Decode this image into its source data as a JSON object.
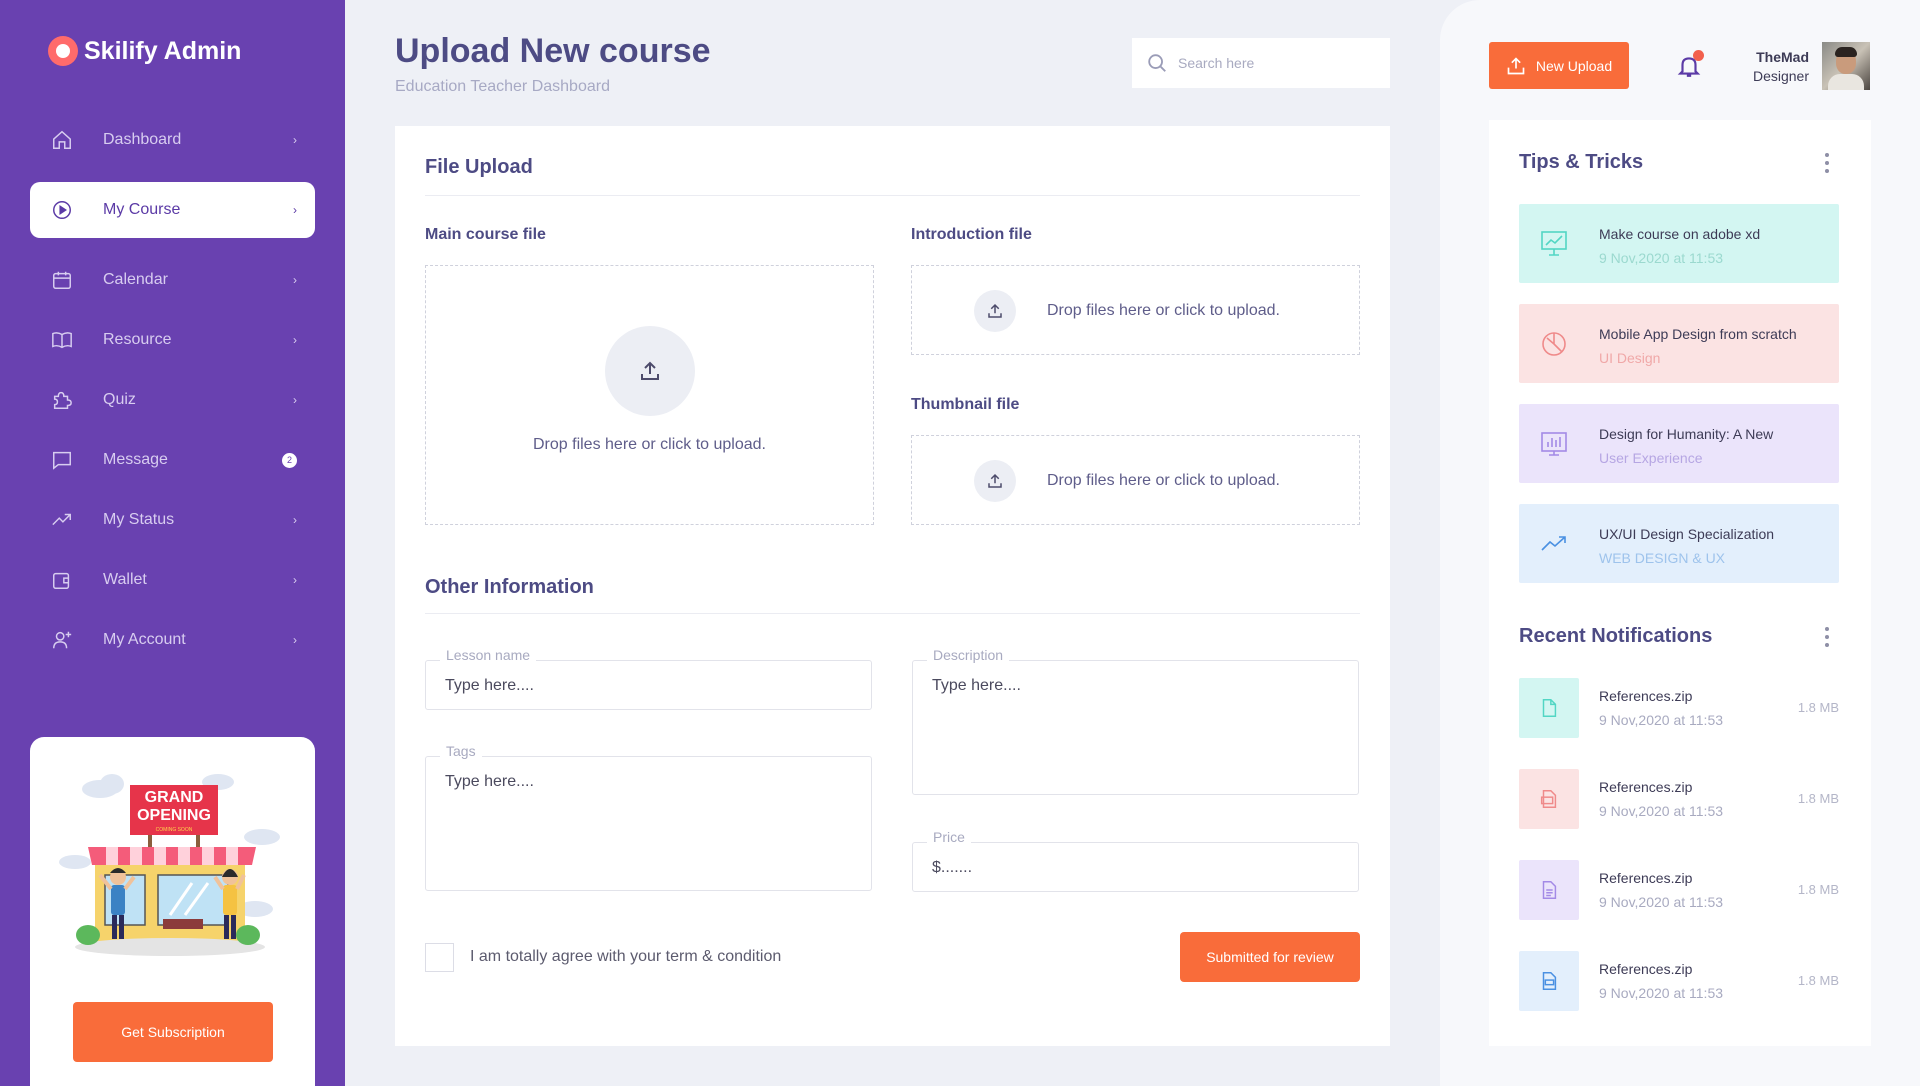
{
  "brand": {
    "name": "Skilify Admin"
  },
  "sidebar": {
    "items": [
      {
        "label": "Dashboard",
        "icon": "home-icon",
        "active": false
      },
      {
        "label": "My Course",
        "icon": "play-circle-icon",
        "active": true
      },
      {
        "label": "Calendar",
        "icon": "calendar-icon",
        "active": false
      },
      {
        "label": "Resource",
        "icon": "book-icon",
        "active": false
      },
      {
        "label": "Quiz",
        "icon": "puzzle-icon",
        "active": false
      },
      {
        "label": "Message",
        "icon": "message-icon",
        "active": false,
        "badge": "2"
      },
      {
        "label": "My Status",
        "icon": "trending-up-icon",
        "active": false
      },
      {
        "label": "Wallet",
        "icon": "wallet-icon",
        "active": false
      },
      {
        "label": "My Account",
        "icon": "user-plus-icon",
        "active": false
      }
    ],
    "promo": {
      "sign_line1": "GRAND",
      "sign_line2": "OPENING",
      "sign_line3": "COMING SOON",
      "button_label": "Get Subscription"
    }
  },
  "header": {
    "title": "Upload New course",
    "subtitle": "Education Teacher Dashboard",
    "search_placeholder": "Search here"
  },
  "file_upload": {
    "title": "File Upload",
    "main_label": "Main course file",
    "intro_label": "Introduction file",
    "thumb_label": "Thumbnail file",
    "drop_text": "Drop files here or click to upload."
  },
  "other_info": {
    "title": "Other Information",
    "lesson_name": {
      "label": "Lesson name",
      "value": "Type here...."
    },
    "tags": {
      "label": "Tags",
      "value": "Type here...."
    },
    "description": {
      "label": "Description",
      "value": "Type here...."
    },
    "price": {
      "label": "Price",
      "value": "$......."
    },
    "agree_text": "I am totally agree with your term & condition",
    "submit_label": "Submitted for review"
  },
  "topbar": {
    "upload_label": "New Upload",
    "user_name": "TheMad",
    "user_role": "Designer"
  },
  "tips": {
    "title": "Tips & Tricks",
    "items": [
      {
        "title": "Make course on adobe xd",
        "subtitle": "9 Nov,2020 at 11:53",
        "icon": "presentation-chart-icon",
        "bg": "#d3f6f2",
        "color": "#52d6c4"
      },
      {
        "title": "Mobile App Design from scratch",
        "subtitle": "UI Design",
        "icon": "pie-chart-icon",
        "bg": "#fbe3e3",
        "color": "#ef8a8a"
      },
      {
        "title": "Design for Humanity: A New",
        "subtitle": "User Experience",
        "icon": "bar-chart-icon",
        "bg": "#ebe4fb",
        "color": "#a38ae6"
      },
      {
        "title": "UX/UI Design Specialization",
        "subtitle": "WEB DESIGN & UX",
        "icon": "trending-up-icon",
        "bg": "#e3effc",
        "color": "#4a90e2"
      }
    ]
  },
  "notifications": {
    "title": "Recent Notifications",
    "items": [
      {
        "title": "References.zip",
        "subtitle": "9 Nov,2020 at 11:53",
        "size": "1.8 MB",
        "icon": "file-icon",
        "bg": "#d3f6f2",
        "color": "#52d6c4"
      },
      {
        "title": "References.zip",
        "subtitle": "9 Nov,2020 at 11:53",
        "size": "1.8 MB",
        "icon": "file-image-icon",
        "bg": "#fbe3e3",
        "color": "#ef8a8a"
      },
      {
        "title": "References.zip",
        "subtitle": "9 Nov,2020 at 11:53",
        "size": "1.8 MB",
        "icon": "file-text-icon",
        "bg": "#ebe4fb",
        "color": "#a38ae6"
      },
      {
        "title": "References.zip",
        "subtitle": "9 Nov,2020 at 11:53",
        "size": "1.8 MB",
        "icon": "file-pdf-icon",
        "bg": "#e3effc",
        "color": "#4a90e2"
      }
    ]
  },
  "colors": {
    "primary": "#6941b0",
    "accent": "#f96c3a",
    "heading": "#4d4b84"
  }
}
